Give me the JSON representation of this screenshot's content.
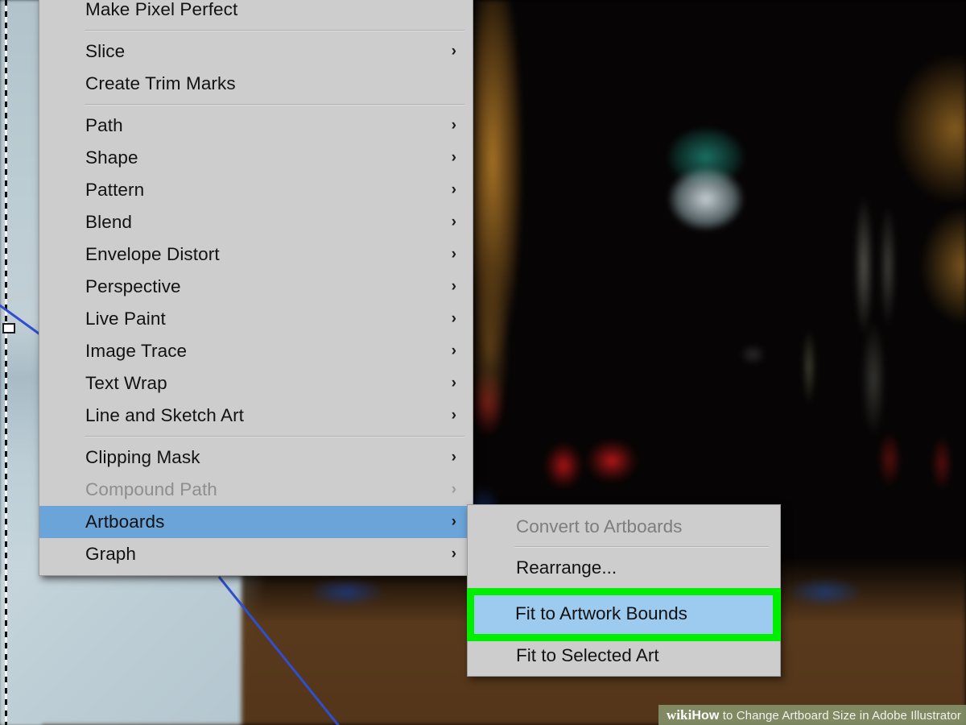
{
  "app": {
    "name": "Adobe Illustrator",
    "canvas_background_color": "#b9c9d1",
    "artboard_edge_color": "#111111",
    "path_stroke_color": "#2f4fd0"
  },
  "context_menu": {
    "name": "Object menu",
    "background_color": "#cdcdcd",
    "highlight_color": "#6aa4d8",
    "items": [
      {
        "label": "Make Pixel Perfect",
        "submenu": false,
        "disabled": false,
        "selected": false
      },
      {
        "label": "Slice",
        "submenu": true,
        "disabled": false,
        "selected": false
      },
      {
        "label": "Create Trim Marks",
        "submenu": false,
        "disabled": false,
        "selected": false
      },
      {
        "label": "Path",
        "submenu": true,
        "disabled": false,
        "selected": false
      },
      {
        "label": "Shape",
        "submenu": true,
        "disabled": false,
        "selected": false
      },
      {
        "label": "Pattern",
        "submenu": true,
        "disabled": false,
        "selected": false
      },
      {
        "label": "Blend",
        "submenu": true,
        "disabled": false,
        "selected": false
      },
      {
        "label": "Envelope Distort",
        "submenu": true,
        "disabled": false,
        "selected": false
      },
      {
        "label": "Perspective",
        "submenu": true,
        "disabled": false,
        "selected": false
      },
      {
        "label": "Live Paint",
        "submenu": true,
        "disabled": false,
        "selected": false
      },
      {
        "label": "Image Trace",
        "submenu": true,
        "disabled": false,
        "selected": false
      },
      {
        "label": "Text Wrap",
        "submenu": true,
        "disabled": false,
        "selected": false
      },
      {
        "label": "Line and Sketch Art",
        "submenu": true,
        "disabled": false,
        "selected": false
      },
      {
        "label": "Clipping Mask",
        "submenu": true,
        "disabled": false,
        "selected": false
      },
      {
        "label": "Compound Path",
        "submenu": true,
        "disabled": true,
        "selected": false
      },
      {
        "label": "Artboards",
        "submenu": true,
        "disabled": false,
        "selected": true
      },
      {
        "label": "Graph",
        "submenu": true,
        "disabled": false,
        "selected": false
      }
    ],
    "submenu_arrow_glyph": "›"
  },
  "submenu": {
    "name": "Artboards submenu",
    "parent_label": "Artboards",
    "highlight_color": "#9dcbf0",
    "callout_color": "#00ee00",
    "items": [
      {
        "label": "Convert to Artboards",
        "disabled": true,
        "highlighted": false
      },
      {
        "label": "Rearrange...",
        "disabled": false,
        "highlighted": false
      },
      {
        "label": "Fit to Artwork Bounds",
        "disabled": false,
        "highlighted": true
      },
      {
        "label": "Fit to Selected Art",
        "disabled": false,
        "highlighted": false
      }
    ]
  },
  "watermark": {
    "brand_wiki": "wiki",
    "brand_how": "How",
    "text": " to Change Artboard Size in Adobe Illustrator",
    "background_color": "#8a9c71"
  }
}
